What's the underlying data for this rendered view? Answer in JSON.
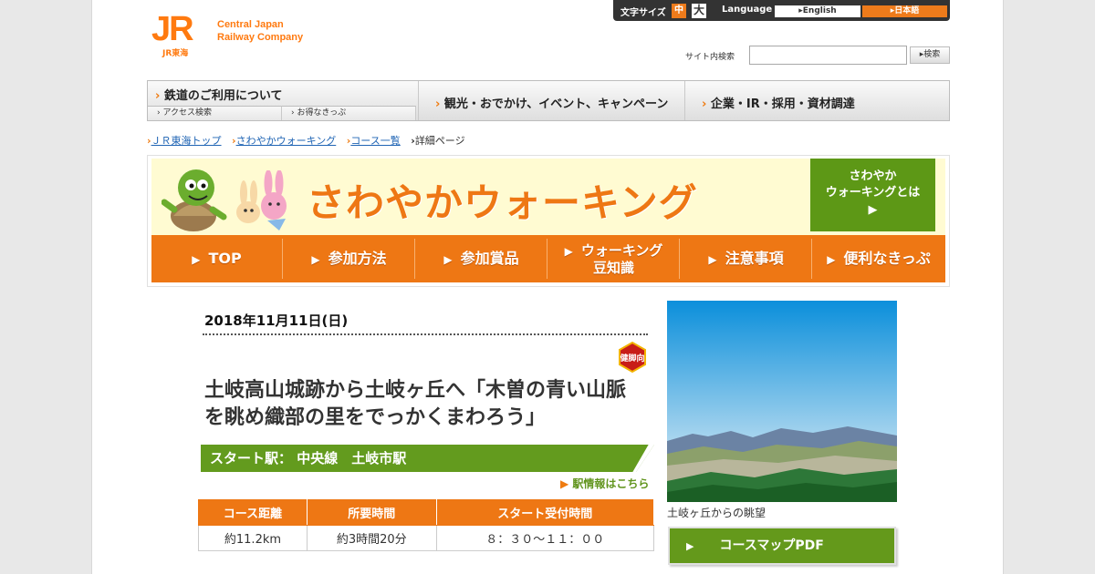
{
  "logo": {
    "mark": "JR",
    "sub": "JR東海",
    "line1": "Central Japan",
    "line2": "Railway Company"
  },
  "utility": {
    "text_size_label": "文字サイズ",
    "size_medium": "中",
    "size_large": "大",
    "language_label": "Language",
    "english": "▸English",
    "japanese": "▸日本語"
  },
  "search": {
    "label": "サイト内検索",
    "placeholder": "",
    "button": "▸検索"
  },
  "global_nav": {
    "rail": "鉄道のご利用について",
    "access": "アクセス検索",
    "tickets": "お得なきっぷ",
    "tourism": "観光・おでかけ、イベント、キャンペーン",
    "corporate": "企業・IR・採用・資材調達"
  },
  "breadcrumbs": [
    "ＪＲ東海トップ",
    "さわやかウォーキング",
    "コース一覧",
    "詳細ページ"
  ],
  "banner": {
    "title": "さわやかウォーキング",
    "about_line1": "さわやか",
    "about_line2": "ウォーキングとは",
    "menu": [
      "TOP",
      "参加方法",
      "参加賞品",
      "ウォーキング",
      "豆知識",
      "注意事項",
      "便利なきっぷ"
    ]
  },
  "event": {
    "date": "2018年11月11日(日)",
    "badge": "健脚向",
    "title_line1": "土岐高山城跡から土岐ヶ丘へ「木曽の青い山脈",
    "title_line2": "を眺め織部の里をでっかくまわろう」",
    "start_station": "スタート駅：  中央線　土岐市駅",
    "station_info": "駅情報はこちら",
    "table_headers": [
      "コース距離",
      "所要時間",
      "スタート受付時間"
    ],
    "table_values": [
      "約11.2km",
      "約3時間20分",
      "８：３０～１１：００"
    ],
    "photo_caption": "土岐ヶ丘からの眺望",
    "map_pdf": "コースマップPDF"
  },
  "colors": {
    "accent_orange": "#ee7714",
    "green": "#639b1e",
    "link_blue": "#1f64b4"
  }
}
